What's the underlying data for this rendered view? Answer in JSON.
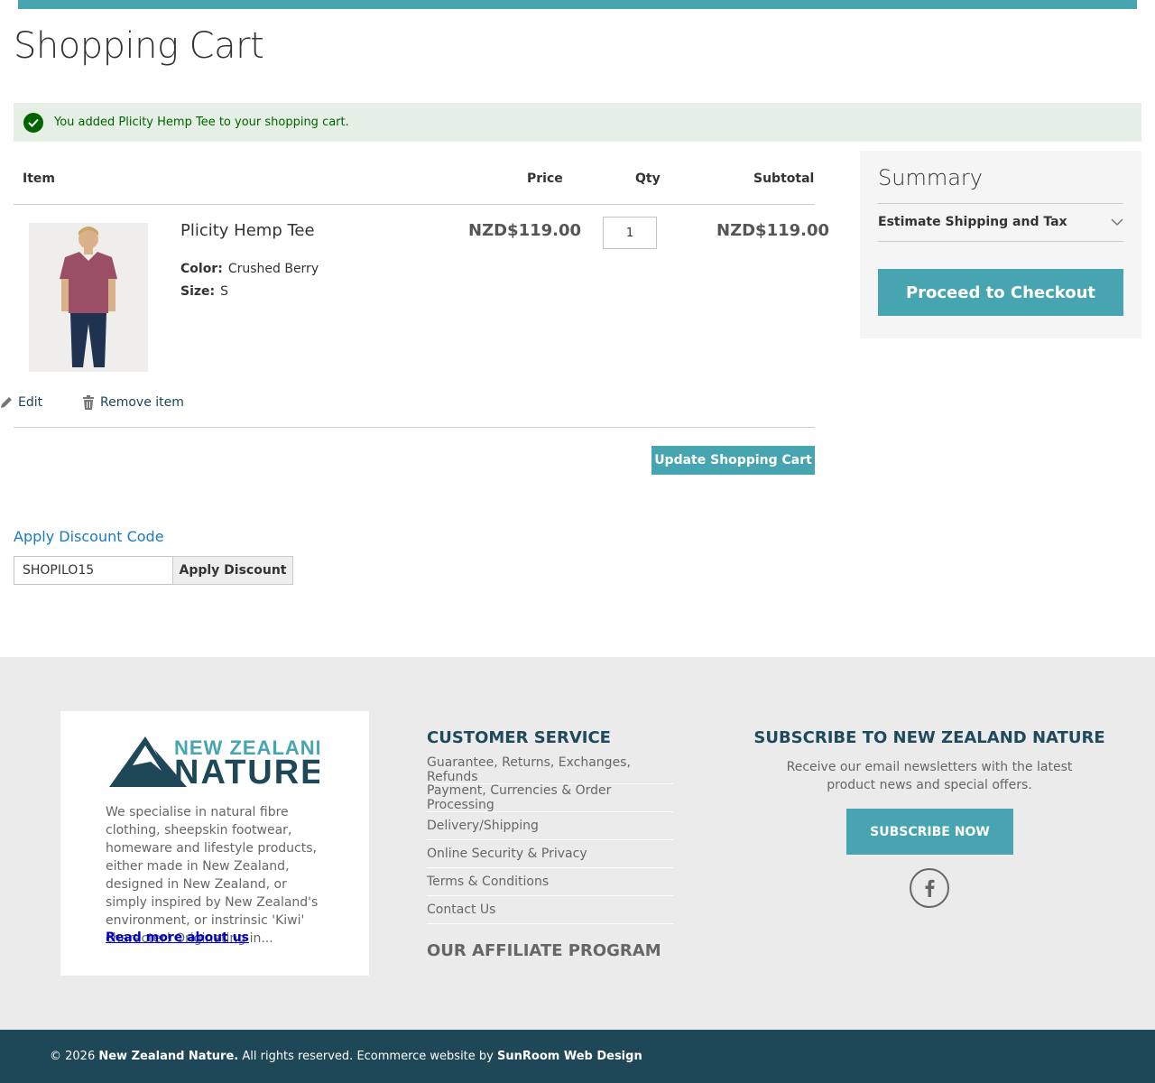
{
  "colors": {
    "accent": "#46a5b1",
    "success": "#006400",
    "footer_dark": "#1e4757",
    "link": "#1979c3"
  },
  "page": {
    "title": "Shopping Cart"
  },
  "message": {
    "text": "You added Plicity Hemp Tee to your shopping cart.",
    "icon": "check-circle-icon"
  },
  "cart": {
    "headers": {
      "item": "Item",
      "price": "Price",
      "qty": "Qty",
      "subtotal": "Subtotal"
    },
    "items": [
      {
        "name": "Plicity Hemp Tee",
        "options": [
          {
            "label": "Color:",
            "value": "Crushed Berry"
          },
          {
            "label": "Size:",
            "value": "S"
          }
        ],
        "price": "NZD$119.00",
        "qty": "1",
        "subtotal": "NZD$119.00"
      }
    ],
    "edit_label": "Edit",
    "remove_label": "Remove item",
    "update_label": "Update Shopping Cart"
  },
  "discount": {
    "title": "Apply Discount Code",
    "value": "SHOPILO15",
    "button": "Apply Discount"
  },
  "summary": {
    "title": "Summary",
    "shipping_label": "Estimate Shipping and Tax",
    "checkout_label": "Proceed to Checkout"
  },
  "footer": {
    "logo": {
      "line1": "NEW ZEALAND",
      "line2": "NATURE"
    },
    "about_text": "We specialise in natural fibre clothing, sheepskin footwear, homeware and lifestyle products, either made in New Zealand, designed in New Zealand, or simply inspired by New Zealand's environment, or instrinsic 'Kiwi' character!  Originating in...",
    "about_link": "Read more about us",
    "customer_service": {
      "title": "CUSTOMER SERVICE",
      "links": [
        "Guarantee, Returns, Exchanges, Refunds",
        "Payment, Currencies & Order Processing",
        "Delivery/Shipping",
        "Online Security & Privacy",
        "Terms & Conditions",
        "Contact Us"
      ]
    },
    "affiliate_title": "OUR AFFILIATE PROGRAM",
    "subscribe": {
      "title": "SUBSCRIBE TO NEW ZEALAND NATURE",
      "text": "Receive our email newsletters with the latest product news and special offers.",
      "button": "SUBSCRIBE NOW",
      "social_icon": "facebook-icon"
    },
    "copyright": {
      "prefix": "© 2026",
      "brand": "New Zealand Nature.",
      "middle": "All rights reserved. Ecommerce website by",
      "designer": "SunRoom Web Design"
    }
  }
}
